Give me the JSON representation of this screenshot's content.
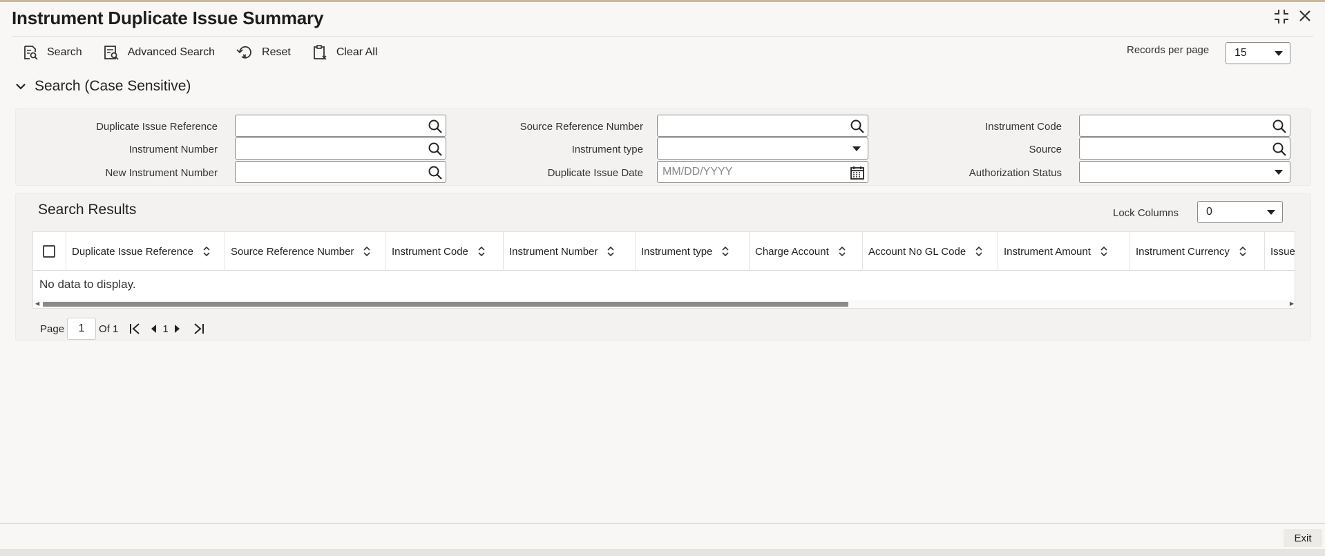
{
  "window": {
    "title": "Instrument Duplicate Issue Summary"
  },
  "toolbar": {
    "search_label": "Search",
    "advanced_search_label": "Advanced Search",
    "reset_label": "Reset",
    "clear_all_label": "Clear All"
  },
  "records_per_page": {
    "label": "Records per page",
    "value": "15"
  },
  "search_section": {
    "title": "Search (Case Sensitive)",
    "fields": {
      "duplicate_issue_reference": {
        "label": "Duplicate Issue Reference",
        "value": ""
      },
      "source_reference_number": {
        "label": "Source Reference Number",
        "value": ""
      },
      "instrument_code": {
        "label": "Instrument Code",
        "value": ""
      },
      "instrument_number": {
        "label": "Instrument Number",
        "value": ""
      },
      "instrument_type": {
        "label": "Instrument type",
        "value": ""
      },
      "source": {
        "label": "Source",
        "value": ""
      },
      "new_instrument_number": {
        "label": "New Instrument Number",
        "value": ""
      },
      "duplicate_issue_date": {
        "label": "Duplicate Issue Date",
        "placeholder": "MM/DD/YYYY"
      },
      "authorization_status": {
        "label": "Authorization Status",
        "value": ""
      }
    }
  },
  "results": {
    "title": "Search Results",
    "lock_columns_label": "Lock Columns",
    "lock_columns_value": "0",
    "columns": [
      "Duplicate Issue Reference",
      "Source Reference Number",
      "Instrument Code",
      "Instrument Number",
      "Instrument type",
      "Charge Account",
      "Account No GL Code",
      "Instrument Amount",
      "Instrument Currency",
      "Issue"
    ],
    "empty_text": "No data to display."
  },
  "pagination": {
    "page_label": "Page",
    "current_page": "1",
    "of_label": "Of 1",
    "nav_page": "1"
  },
  "footer": {
    "exit_label": "Exit"
  },
  "icons": {
    "search": "magnifier-icon",
    "calendar": "calendar-icon",
    "collapse": "chevron-down-icon",
    "sort": "sort-updown-icon"
  }
}
